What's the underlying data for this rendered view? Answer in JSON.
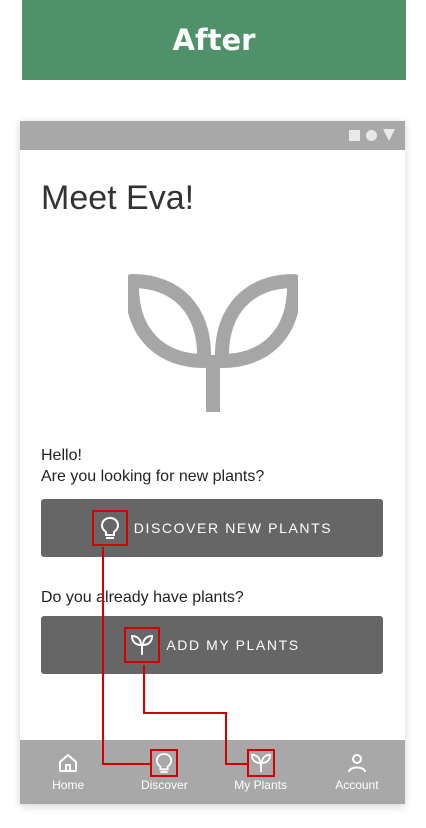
{
  "banner": {
    "title": "After"
  },
  "screen": {
    "title": "Meet Eva!",
    "greeting_line1": "Hello!",
    "greeting_line2": "Are you looking for new plants?",
    "discover_button": {
      "label": "DISCOVER NEW PLANTS",
      "icon": "lightbulb-icon"
    },
    "question": "Do you already have plants?",
    "add_button": {
      "label": "ADD MY PLANTS",
      "icon": "sprout-icon"
    },
    "hero_icon": "sprout-icon"
  },
  "statusbar": {
    "icons": [
      "square-icon",
      "circle-icon",
      "triangle-icon"
    ]
  },
  "nav": {
    "items": [
      {
        "label": "Home",
        "icon": "home-icon"
      },
      {
        "label": "Discover",
        "icon": "lightbulb-icon"
      },
      {
        "label": "My Plants",
        "icon": "sprout-icon"
      },
      {
        "label": "Account",
        "icon": "user-icon"
      }
    ]
  },
  "colors": {
    "banner": "#4f9168",
    "button": "#666666",
    "bars": "#a8a8a8",
    "highlight": "#d40000"
  }
}
